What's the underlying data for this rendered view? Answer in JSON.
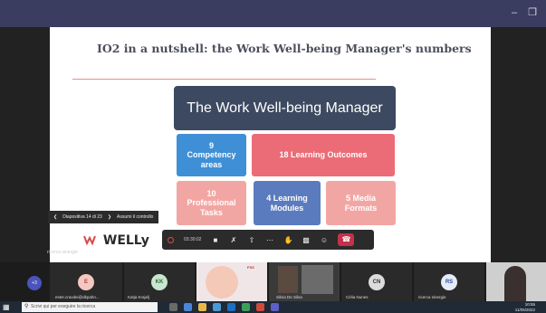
{
  "window": {
    "minimize_label": "–",
    "maximize_label": "❐"
  },
  "slide": {
    "title": "IO2 in a nutshell: the Work Well-being Manager's numbers",
    "header_box": "The Work Well-being Manager",
    "boxes": [
      {
        "line1": "9",
        "line2": "Competency",
        "line3": "areas"
      },
      {
        "text": "18 Learning Outcomes"
      },
      {
        "line1": "10",
        "line2": "Professional",
        "line3": "Tasks"
      },
      {
        "line1": "4 Learning",
        "line2": "Modules"
      },
      {
        "line1": "5 Media",
        "line2": "Formats"
      }
    ],
    "logo_text": "WELLy"
  },
  "slide_nav": {
    "prev_icon": "chevron-left-icon",
    "counter": "Diapositiva 14 di 23",
    "next_icon": "chevron-right-icon",
    "take_control": "Assumi il controllo"
  },
  "presenter_label": "ricerca sinergie",
  "call_bar": {
    "timer": "03:30:02",
    "icons": [
      "video-icon",
      "mic-off-icon",
      "share-icon",
      "more-icon",
      "hand-icon",
      "chat-icon",
      "participants-icon",
      "hangup-icon"
    ]
  },
  "participants": {
    "more_count": "+3",
    "tiles": [
      {
        "initials": "E",
        "name": "ester.cravdei@dkpahn...",
        "color": "#f5c7c1",
        "text_color": "#a8443a"
      },
      {
        "initials": "KK",
        "name": "Katja Krajelj",
        "color": "#c8e6d0",
        "text_color": "#2f6b43"
      },
      {
        "initials": "",
        "name": "",
        "color": "#f0e6e8",
        "text_color": "#333"
      },
      {
        "initials": "",
        "name": "Silvia De Silva",
        "color": "#3a3a3a",
        "text_color": "#fff"
      },
      {
        "initials": "CN",
        "name": "Célia Nunes",
        "color": "#dcdcdc",
        "text_color": "#333"
      },
      {
        "initials": "RS",
        "name": "ricerca sinergie",
        "color": "#e6ecf7",
        "text_color": "#2d4f9e"
      },
      {
        "initials": "",
        "name": "",
        "color": "#cfcfcf",
        "text_color": "#333"
      }
    ]
  },
  "taskbar": {
    "search_placeholder": "Scrivi qui per eseguire la ricerca",
    "time": "10:55",
    "date": "11/05/2022"
  }
}
